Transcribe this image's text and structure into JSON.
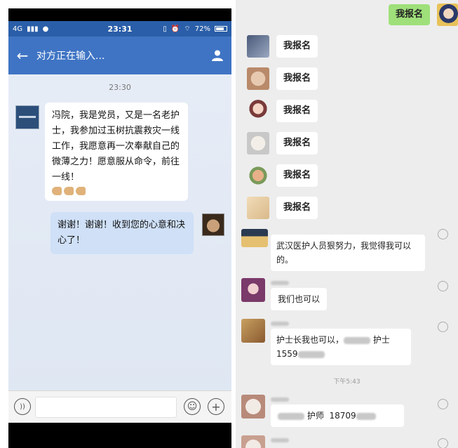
{
  "left_phone": {
    "status_bar": {
      "network": "4G",
      "time": "23:31",
      "battery": "72%"
    },
    "nav": {
      "title": "对方正在输入..."
    },
    "chat": {
      "timestamp": "23:30",
      "messages": [
        {
          "direction": "incoming",
          "text": "冯院，我是党员，又是一名老护士，我参加过玉树抗震救灾一线工作，我愿意再一次奉献自己的微薄之力！愿意服从命令，前往一线！",
          "emoji": "💪💪💪"
        },
        {
          "direction": "outgoing",
          "text": "谢谢！谢谢！收到您的心意和决心了！"
        }
      ]
    }
  },
  "right_chat": {
    "top_message": "我报名",
    "messages": [
      {
        "text": "我报名"
      },
      {
        "text": "我报名"
      },
      {
        "text": "我报名"
      },
      {
        "text": "我报名"
      },
      {
        "text": "我报名"
      },
      {
        "text": "我报名"
      },
      {
        "text": "武汉医护人员狠努力，我觉得我可以的。"
      },
      {
        "text": "我们也可以"
      },
      {
        "text_line1": "护士长我也可以，",
        "text_line1_end": "护士",
        "text_line2": "1559"
      },
      {
        "text_a": "护师",
        "text_b": "18709"
      }
    ],
    "time_divider": "下午5:43"
  }
}
